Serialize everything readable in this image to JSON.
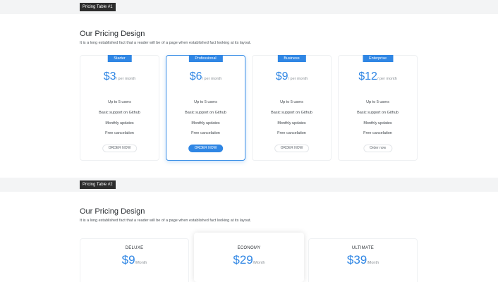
{
  "section1": {
    "tag": "Pricing Table #1",
    "title": "Our Pricing Design",
    "subtitle": "It is a long established fact that a reader will be of a page when established fact looking at its layout.",
    "plans": [
      {
        "name": "Starter",
        "amount": "$3",
        "period": "/ per month",
        "features": [
          "Up to 5 users",
          "Basic support on Github",
          "Monthly updates",
          "Free cancelation"
        ],
        "button": "ORDER NOW"
      },
      {
        "name": "Professional",
        "amount": "$6",
        "period": "/ per month",
        "features": [
          "Up to 5 users",
          "Basic support on Github",
          "Monthly updates",
          "Free cancelation"
        ],
        "button": "ORDER NOW"
      },
      {
        "name": "Business",
        "amount": "$9",
        "period": "/ per month",
        "features": [
          "Up to 5 users",
          "Basic support on Github",
          "Monthly updates",
          "Free cancelation"
        ],
        "button": "ORDER NOW"
      },
      {
        "name": "Enterprise",
        "amount": "$12",
        "period": "/ per month",
        "features": [
          "Up to 5 users",
          "Basic support on Github",
          "Monthly updates",
          "Free cancelation"
        ],
        "button": "Order now"
      }
    ]
  },
  "section2": {
    "tag": "Pricing Table #2",
    "title": "Our Pricing Design",
    "subtitle": "It is a long established fact that a reader will be of a page when established fact looking at its layout.",
    "plans": [
      {
        "name": "DELUXE",
        "amount": "$9",
        "period": "/Month"
      },
      {
        "name": "ECONOMY",
        "amount": "$29",
        "period": "/Month"
      },
      {
        "name": "ULTIMATE",
        "amount": "$39",
        "period": "/Month"
      }
    ]
  },
  "colors": {
    "accent": "#2f86e4",
    "band": "#f3f4f5",
    "tag_bg": "#2d2d2d"
  }
}
